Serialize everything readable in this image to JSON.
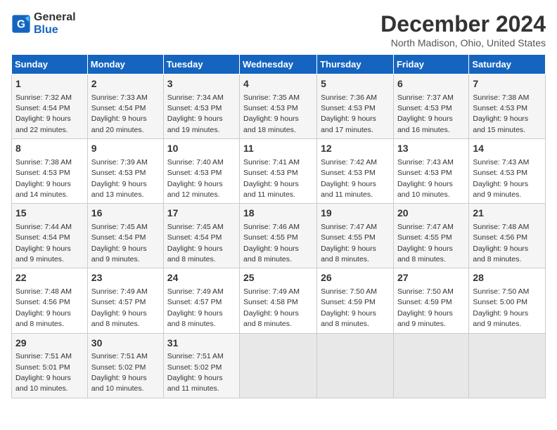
{
  "logo": {
    "line1": "General",
    "line2": "Blue"
  },
  "title": "December 2024",
  "subtitle": "North Madison, Ohio, United States",
  "days_of_week": [
    "Sunday",
    "Monday",
    "Tuesday",
    "Wednesday",
    "Thursday",
    "Friday",
    "Saturday"
  ],
  "weeks": [
    [
      {
        "day": "1",
        "sunrise": "7:32 AM",
        "sunset": "4:54 PM",
        "daylight": "9 hours and 22 minutes."
      },
      {
        "day": "2",
        "sunrise": "7:33 AM",
        "sunset": "4:54 PM",
        "daylight": "9 hours and 20 minutes."
      },
      {
        "day": "3",
        "sunrise": "7:34 AM",
        "sunset": "4:53 PM",
        "daylight": "9 hours and 19 minutes."
      },
      {
        "day": "4",
        "sunrise": "7:35 AM",
        "sunset": "4:53 PM",
        "daylight": "9 hours and 18 minutes."
      },
      {
        "day": "5",
        "sunrise": "7:36 AM",
        "sunset": "4:53 PM",
        "daylight": "9 hours and 17 minutes."
      },
      {
        "day": "6",
        "sunrise": "7:37 AM",
        "sunset": "4:53 PM",
        "daylight": "9 hours and 16 minutes."
      },
      {
        "day": "7",
        "sunrise": "7:38 AM",
        "sunset": "4:53 PM",
        "daylight": "9 hours and 15 minutes."
      }
    ],
    [
      {
        "day": "8",
        "sunrise": "7:38 AM",
        "sunset": "4:53 PM",
        "daylight": "9 hours and 14 minutes."
      },
      {
        "day": "9",
        "sunrise": "7:39 AM",
        "sunset": "4:53 PM",
        "daylight": "9 hours and 13 minutes."
      },
      {
        "day": "10",
        "sunrise": "7:40 AM",
        "sunset": "4:53 PM",
        "daylight": "9 hours and 12 minutes."
      },
      {
        "day": "11",
        "sunrise": "7:41 AM",
        "sunset": "4:53 PM",
        "daylight": "9 hours and 11 minutes."
      },
      {
        "day": "12",
        "sunrise": "7:42 AM",
        "sunset": "4:53 PM",
        "daylight": "9 hours and 11 minutes."
      },
      {
        "day": "13",
        "sunrise": "7:43 AM",
        "sunset": "4:53 PM",
        "daylight": "9 hours and 10 minutes."
      },
      {
        "day": "14",
        "sunrise": "7:43 AM",
        "sunset": "4:53 PM",
        "daylight": "9 hours and 9 minutes."
      }
    ],
    [
      {
        "day": "15",
        "sunrise": "7:44 AM",
        "sunset": "4:54 PM",
        "daylight": "9 hours and 9 minutes."
      },
      {
        "day": "16",
        "sunrise": "7:45 AM",
        "sunset": "4:54 PM",
        "daylight": "9 hours and 9 minutes."
      },
      {
        "day": "17",
        "sunrise": "7:45 AM",
        "sunset": "4:54 PM",
        "daylight": "9 hours and 8 minutes."
      },
      {
        "day": "18",
        "sunrise": "7:46 AM",
        "sunset": "4:55 PM",
        "daylight": "9 hours and 8 minutes."
      },
      {
        "day": "19",
        "sunrise": "7:47 AM",
        "sunset": "4:55 PM",
        "daylight": "9 hours and 8 minutes."
      },
      {
        "day": "20",
        "sunrise": "7:47 AM",
        "sunset": "4:55 PM",
        "daylight": "9 hours and 8 minutes."
      },
      {
        "day": "21",
        "sunrise": "7:48 AM",
        "sunset": "4:56 PM",
        "daylight": "9 hours and 8 minutes."
      }
    ],
    [
      {
        "day": "22",
        "sunrise": "7:48 AM",
        "sunset": "4:56 PM",
        "daylight": "9 hours and 8 minutes."
      },
      {
        "day": "23",
        "sunrise": "7:49 AM",
        "sunset": "4:57 PM",
        "daylight": "9 hours and 8 minutes."
      },
      {
        "day": "24",
        "sunrise": "7:49 AM",
        "sunset": "4:57 PM",
        "daylight": "9 hours and 8 minutes."
      },
      {
        "day": "25",
        "sunrise": "7:49 AM",
        "sunset": "4:58 PM",
        "daylight": "9 hours and 8 minutes."
      },
      {
        "day": "26",
        "sunrise": "7:50 AM",
        "sunset": "4:59 PM",
        "daylight": "9 hours and 8 minutes."
      },
      {
        "day": "27",
        "sunrise": "7:50 AM",
        "sunset": "4:59 PM",
        "daylight": "9 hours and 9 minutes."
      },
      {
        "day": "28",
        "sunrise": "7:50 AM",
        "sunset": "5:00 PM",
        "daylight": "9 hours and 9 minutes."
      }
    ],
    [
      {
        "day": "29",
        "sunrise": "7:51 AM",
        "sunset": "5:01 PM",
        "daylight": "9 hours and 10 minutes."
      },
      {
        "day": "30",
        "sunrise": "7:51 AM",
        "sunset": "5:02 PM",
        "daylight": "9 hours and 10 minutes."
      },
      {
        "day": "31",
        "sunrise": "7:51 AM",
        "sunset": "5:02 PM",
        "daylight": "9 hours and 11 minutes."
      },
      null,
      null,
      null,
      null
    ]
  ]
}
